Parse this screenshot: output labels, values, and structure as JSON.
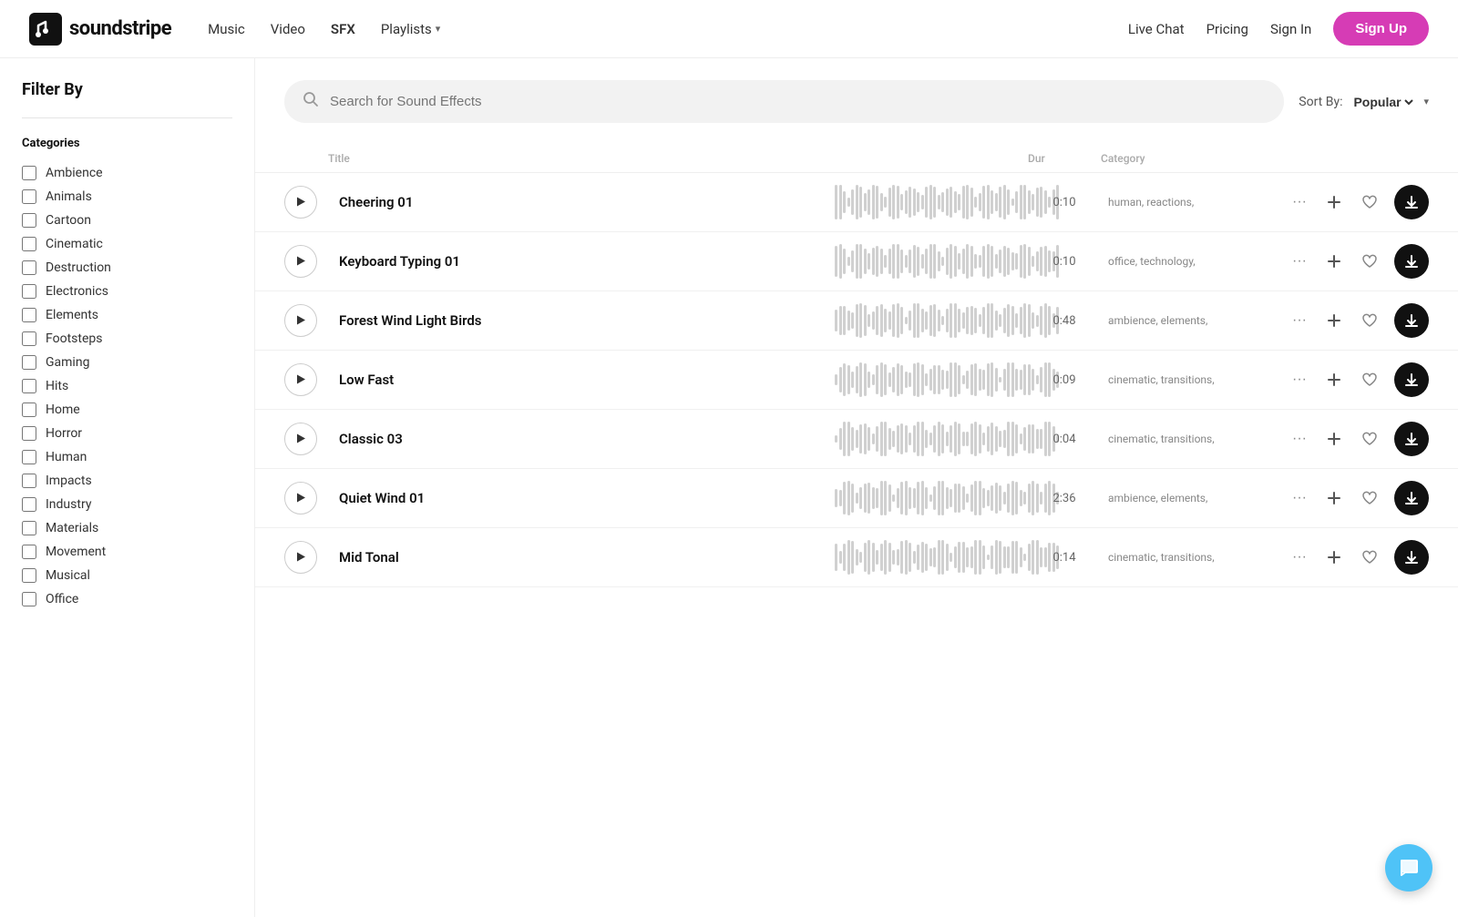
{
  "header": {
    "logo_text": "soundstripe",
    "nav": [
      {
        "label": "Music",
        "active": false
      },
      {
        "label": "Video",
        "active": false
      },
      {
        "label": "SFX",
        "active": true
      },
      {
        "label": "Playlists",
        "active": false,
        "has_chevron": true
      }
    ],
    "right_links": [
      {
        "label": "Live Chat"
      },
      {
        "label": "Pricing"
      },
      {
        "label": "Sign In"
      }
    ],
    "signup_label": "Sign Up"
  },
  "sidebar": {
    "filter_by": "Filter By",
    "categories_label": "Categories",
    "categories": [
      {
        "label": "Ambience",
        "checked": false
      },
      {
        "label": "Animals",
        "checked": false
      },
      {
        "label": "Cartoon",
        "checked": false
      },
      {
        "label": "Cinematic",
        "checked": false
      },
      {
        "label": "Destruction",
        "checked": false
      },
      {
        "label": "Electronics",
        "checked": false
      },
      {
        "label": "Elements",
        "checked": false
      },
      {
        "label": "Footsteps",
        "checked": false
      },
      {
        "label": "Gaming",
        "checked": false
      },
      {
        "label": "Hits",
        "checked": false
      },
      {
        "label": "Home",
        "checked": false
      },
      {
        "label": "Horror",
        "checked": false
      },
      {
        "label": "Human",
        "checked": false
      },
      {
        "label": "Impacts",
        "checked": false
      },
      {
        "label": "Industry",
        "checked": false
      },
      {
        "label": "Materials",
        "checked": false
      },
      {
        "label": "Movement",
        "checked": false
      },
      {
        "label": "Musical",
        "checked": false
      },
      {
        "label": "Office",
        "checked": false
      }
    ]
  },
  "search": {
    "placeholder": "Search for Sound Effects"
  },
  "sort": {
    "label": "Sort By:",
    "value": "Popular"
  },
  "table": {
    "headers": [
      {
        "label": ""
      },
      {
        "label": "Title"
      },
      {
        "label": ""
      },
      {
        "label": "Dur"
      },
      {
        "label": "Category"
      },
      {
        "label": ""
      }
    ],
    "tracks": [
      {
        "title": "Cheering 01",
        "duration": "0:10",
        "category": "human,\nreactions,"
      },
      {
        "title": "Keyboard Typing 01",
        "duration": "0:10",
        "category": "office,\ntechnology,"
      },
      {
        "title": "Forest Wind Light Birds",
        "duration": "0:48",
        "category": "ambience,\nelements,"
      },
      {
        "title": "Low Fast",
        "duration": "0:09",
        "category": "cinematic,\ntransitions,"
      },
      {
        "title": "Classic 03",
        "duration": "0:04",
        "category": "cinematic,\ntransitions,"
      },
      {
        "title": "Quiet Wind 01",
        "duration": "2:36",
        "category": "ambience,\nelements,"
      },
      {
        "title": "Mid Tonal",
        "duration": "0:14",
        "category": "cinematic,\ntransitions,"
      }
    ]
  },
  "actions": {
    "more_icon": "···",
    "add_icon": "+",
    "heart_icon": "♡",
    "download_icon": "↓"
  }
}
